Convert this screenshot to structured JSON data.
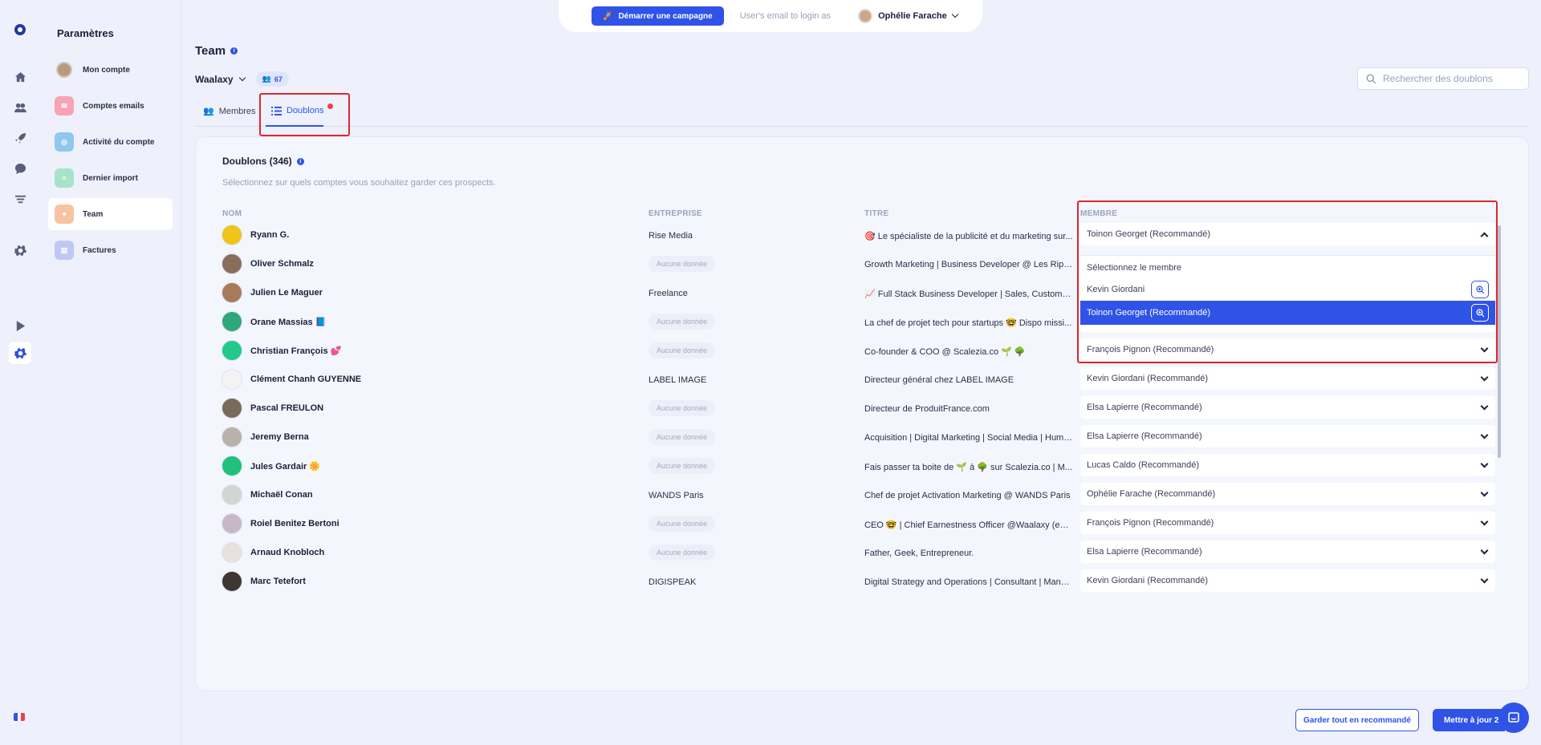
{
  "nav": {
    "rail_icons": [
      "logo-icon",
      "home-icon",
      "users-icon",
      "rocket-icon",
      "chat-icon",
      "filter-icon",
      "settings-icon",
      "play-icon",
      "settings-active-icon"
    ],
    "language_flag": "fr"
  },
  "settings": {
    "title": "Paramètres",
    "items": [
      {
        "label": "Mon compte",
        "icon": "avatar-icon",
        "color": "#b89a7f"
      },
      {
        "label": "Comptes emails",
        "icon": "email-icon",
        "color": "#f7a3b6"
      },
      {
        "label": "Activité du compte",
        "icon": "activity-icon",
        "color": "#8fc7ef"
      },
      {
        "label": "Dernier import",
        "icon": "import-icon",
        "color": "#a7e3c9"
      },
      {
        "label": "Team",
        "icon": "heart-icon",
        "color": "#f7c3a3"
      },
      {
        "label": "Factures",
        "icon": "invoice-icon",
        "color": "#bfc8f5"
      }
    ]
  },
  "topbar": {
    "campaign_button": "Démarrer une campagne",
    "login_placeholder": "User's email to login as",
    "user_name": "Ophélie Farache"
  },
  "header": {
    "title": "Team",
    "team_name": "Waalaxy",
    "member_count": "67",
    "search_placeholder": "Rechercher des doublons"
  },
  "tabs": [
    {
      "label": "Membres",
      "icon": "users-icon"
    },
    {
      "label": "Doublons",
      "icon": "list-icon",
      "active": true
    }
  ],
  "card": {
    "title": "Doublons (346)",
    "subtitle": "Sélectionnez sur quels comptes vous souhaitez garder ces prospects.",
    "columns": [
      "NOM",
      "ENTREPRISE",
      "TITRE",
      "MEMBRE"
    ],
    "empty_label": "Aucune donnée",
    "rows": [
      {
        "name": "Ryann G.",
        "company": "Rise Media",
        "title": "🎯 Le spécialiste de la publicité et du marketing sur...",
        "member": "Toinon Georget (Recommandé)",
        "avatar": "#f0c419",
        "open": true
      },
      {
        "name": "Oliver Schmalz",
        "company": "",
        "title": "Growth Marketing | Business Developer @ Les Ripeurs",
        "member": "",
        "avatar": "#8a6e5c"
      },
      {
        "name": "Julien Le Maguer",
        "company": "Freelance",
        "title": "📈 Full Stack Business Developer | Sales, Custome...",
        "member": "",
        "avatar": "#a67b5b"
      },
      {
        "name": "Orane Massias 📘",
        "company": "",
        "title": "La chef de projet tech pour startups 🤓 Dispo missi...",
        "member": "Toinon Georget (Recommandé)",
        "avatar": "#2ea87a"
      },
      {
        "name": "Christian François 💕",
        "company": "",
        "title": "Co-founder & COO @ Scalezia.co 🌱 🌳",
        "member": "François Pignon (Recommandé)",
        "avatar": "#22c98a"
      },
      {
        "name": "Clément Chanh GUYENNE",
        "company": "LABEL IMAGE",
        "title": "Directeur général chez LABEL IMAGE",
        "member": "Kevin Giordani (Recommandé)",
        "avatar": "#f4f4f4"
      },
      {
        "name": "Pascal FREULON",
        "company": "",
        "title": "Directeur de ProduitFrance.com",
        "member": "Elsa Lapierre (Recommandé)",
        "avatar": "#7a6a5a"
      },
      {
        "name": "Jeremy Berna",
        "company": "",
        "title": "Acquisition | Digital Marketing | Social Media | Huma...",
        "member": "Elsa Lapierre (Recommandé)",
        "avatar": "#b9b1ab"
      },
      {
        "name": "Jules Gardair 🌼",
        "company": "",
        "title": "Fais passer ta boite de 🌱 à 🌳 sur Scalezia.co | M...",
        "member": "Lucas Caldo (Recommandé)",
        "avatar": "#1fc17c"
      },
      {
        "name": "Michaël Conan",
        "company": "WANDS Paris",
        "title": "Chef de projet Activation Marketing @ WANDS Paris",
        "member": "Ophélie Farache (Recommandé)",
        "avatar": "#d4d4d4"
      },
      {
        "name": "Roiel Benitez Bertoni",
        "company": "",
        "title": "CEO 🤓 | Chief Earnestness Officer @Waalaxy (ex P...",
        "member": "François Pignon (Recommandé)",
        "avatar": "#c7b8c8"
      },
      {
        "name": "Arnaud Knobloch",
        "company": "",
        "title": "Father, Geek, Entrepreneur.",
        "member": "Elsa Lapierre (Recommandé)",
        "avatar": "#e8e2dc"
      },
      {
        "name": "Marc Tetefort",
        "company": "DIGISPEAK",
        "title": "Digital Strategy and Operations | Consultant | Mana...",
        "member": "Kevin Giordani (Recommandé)",
        "avatar": "#3d3632"
      }
    ],
    "dropdown": {
      "options": [
        {
          "label": "Sélectionnez le membre",
          "zoom": false,
          "selected": false
        },
        {
          "label": "Kevin Giordani",
          "zoom": true,
          "selected": false
        },
        {
          "label": "Toinon Georget (Recommandé)",
          "zoom": true,
          "selected": true
        }
      ]
    }
  },
  "footer": {
    "keep_all_button": "Garder tout en recommandé",
    "update_button": "Mettre à jour 2("
  },
  "colors": {
    "accent": "#2f53e6",
    "highlight": "#e0262f",
    "background": "#eef1fc"
  }
}
